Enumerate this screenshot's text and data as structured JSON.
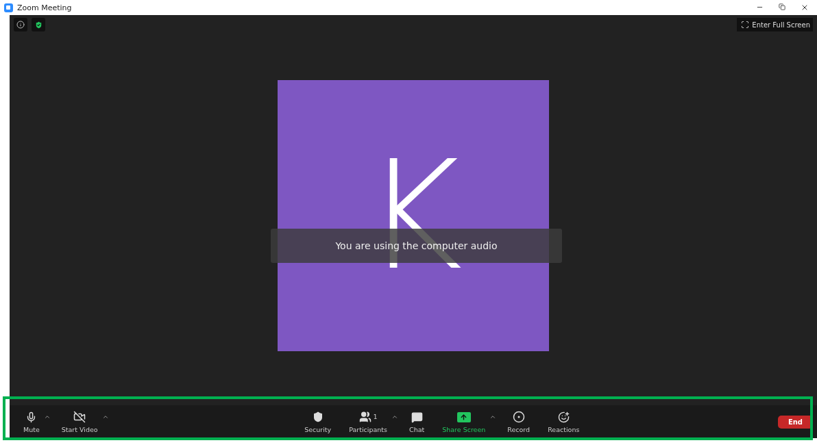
{
  "window": {
    "title": "Zoom Meeting"
  },
  "top_bar": {
    "fullscreen_button": "Enter Full Screen"
  },
  "participant": {
    "initial": "K"
  },
  "notification": "You are using the computer audio",
  "toolbar": {
    "left": [
      {
        "kind": "mute",
        "label": "Mute",
        "has_menu": true
      },
      {
        "kind": "video",
        "label": "Start Video",
        "has_menu": true
      }
    ],
    "center": [
      {
        "kind": "security",
        "label": "Security",
        "has_menu": false
      },
      {
        "kind": "participants",
        "label": "Participants",
        "count": "1",
        "has_menu": true
      },
      {
        "kind": "chat",
        "label": "Chat",
        "has_menu": false
      },
      {
        "kind": "share",
        "label": "Share Screen",
        "has_menu": true
      },
      {
        "kind": "record",
        "label": "Record",
        "has_menu": false
      },
      {
        "kind": "reactions",
        "label": "Reactions",
        "has_menu": false
      }
    ],
    "end_button": "End"
  }
}
